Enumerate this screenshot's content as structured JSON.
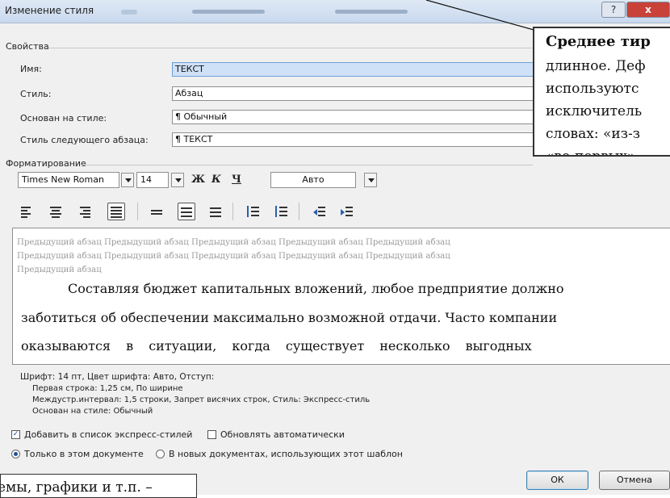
{
  "window": {
    "title": "Изменение стиля",
    "help_glyph": "?",
    "close_glyph": "x"
  },
  "properties": {
    "group_label": "Свойства",
    "name_label": "Имя:",
    "name_value": "ТЕКСТ",
    "style_label": "Стиль:",
    "style_value": "Абзац",
    "based_label": "Основан на стиле:",
    "based_value": "¶ Обычный",
    "next_label": "Стиль следующего абзаца:",
    "next_value": "¶ ТЕКСТ"
  },
  "formatting": {
    "group_label": "Форматирование",
    "font": "Times New Roman",
    "size": "14",
    "bold": "Ж",
    "italic": "К",
    "underline": "Ч",
    "color": "Авто"
  },
  "preview": {
    "ghost_lines": [
      "Предыдущий абзац Предыдущий абзац Предыдущий абзац Предыдущий абзац Предыдущий абзац",
      "Предыдущий абзац Предыдущий абзац Предыдущий абзац Предыдущий абзац Предыдущий абзац",
      "Предыдущий абзац"
    ],
    "body_lines": [
      "Составляя бюджет капитальных вложений, любое предприятие должно",
      "заботиться об обеспечении максимально возможной отдачи. Часто компании",
      "оказываются в ситуации, когда существует несколько выгодных"
    ]
  },
  "description": [
    "Шрифт: 14 пт, Цвет шрифта: Авто, Отступ:",
    "Первая строка:  1,25 см, По ширине",
    "Междустр.интервал:  1,5 строки, Запрет висячих строк, Стиль: Экспресс-стиль",
    "Основан на стиле: Обычный"
  ],
  "options": {
    "add_quick": "Добавить в список экспресс-стилей",
    "add_quick_checked": true,
    "auto_update": "Обновлять автоматически",
    "auto_update_checked": false,
    "only_doc": "Только в этом документе",
    "new_docs": "В новых документах, использующих этот шаблон"
  },
  "buttons": {
    "ok": "ОК",
    "cancel": "Отмена"
  },
  "callout": {
    "heading": "Среднее тир",
    "lines": [
      "длинное. Деф",
      "используютс",
      "исключитель",
      "словах: «из-з",
      "«во-первых»"
    ]
  },
  "footnote": "емы, графики и т.п. –",
  "colors": {
    "accent": "#1c4f9c",
    "close": "#c8423a",
    "ghost_text": "#9a9a9a"
  }
}
